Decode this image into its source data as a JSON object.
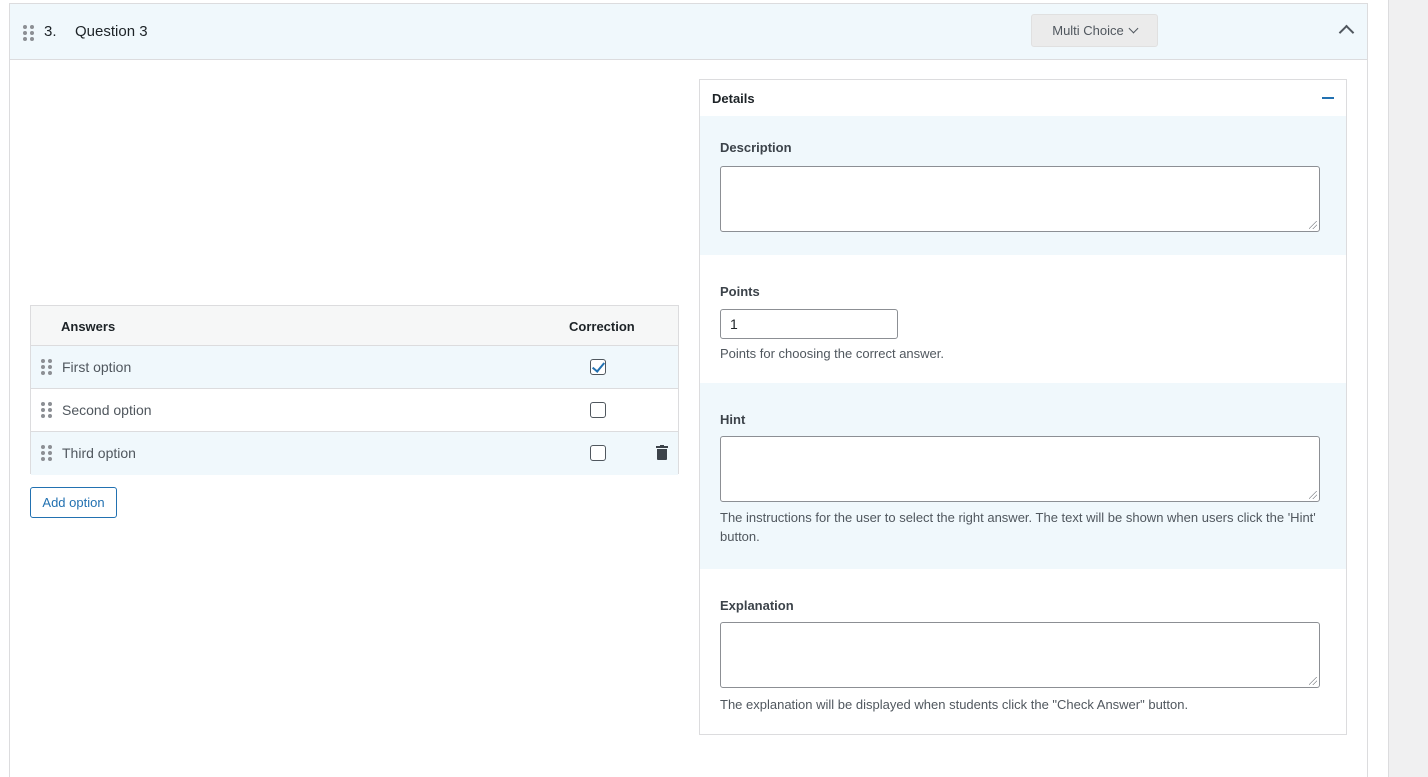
{
  "question": {
    "number": "3.",
    "title": "Question 3",
    "type_label": "Multi Choice"
  },
  "answers": {
    "header_answers": "Answers",
    "header_correction": "Correction",
    "rows": [
      {
        "text": "First option",
        "correct": true
      },
      {
        "text": "Second option",
        "correct": false
      },
      {
        "text": "Third option",
        "correct": false
      }
    ],
    "add_option_label": "Add option"
  },
  "details": {
    "title": "Details",
    "description_label": "Description",
    "description_value": "",
    "points_label": "Points",
    "points_value": "1",
    "points_help": "Points for choosing the correct answer.",
    "hint_label": "Hint",
    "hint_value": "",
    "hint_help": "The instructions for the user to select the right answer. The text will be shown when users click the 'Hint' button.",
    "explanation_label": "Explanation",
    "explanation_value": "",
    "explanation_help": "The explanation will be displayed when students click the \"Check Answer\" button."
  },
  "colors": {
    "accent": "#2271b1",
    "header_bg": "#f0f8fc",
    "border": "#dcdcde"
  }
}
